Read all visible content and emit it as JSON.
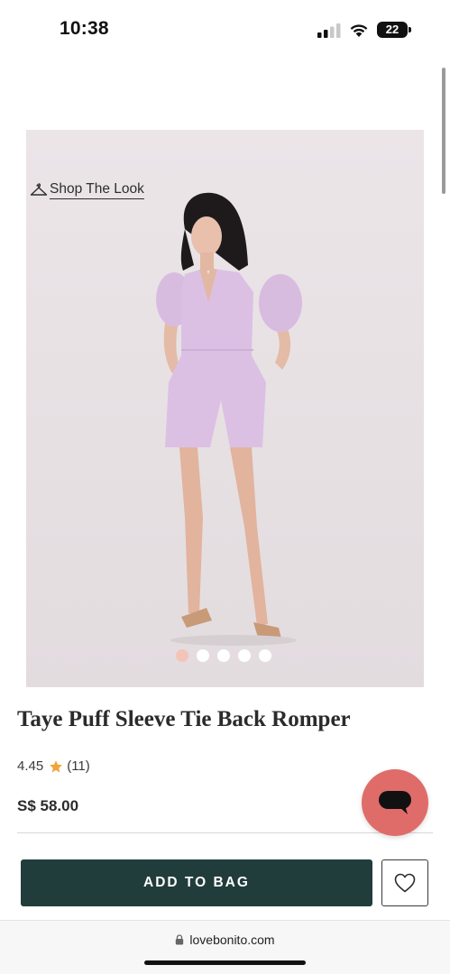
{
  "status_bar": {
    "time": "10:38",
    "battery": "22",
    "icons": [
      "cellular-signal-icon",
      "wifi-icon",
      "battery-icon"
    ]
  },
  "product": {
    "shop_the_look": "Shop The Look",
    "image_alt_icon": "hanger-icon",
    "carousel": {
      "total": 5,
      "active_index": 0
    },
    "title": "Taye Puff Sleeve Tie Back Romper",
    "rating": "4.45",
    "review_count": "(11)",
    "price": "S$ 58.00"
  },
  "actions": {
    "add_to_bag": "ADD TO BAG",
    "wishlist_icon": "heart-icon",
    "chat_icon": "chat-bubble-icon"
  },
  "browser": {
    "url": "lovebonito.com"
  },
  "colors": {
    "accent_dark_green": "#213d3b",
    "chat_button": "#e06c6a",
    "star": "#f0a53a",
    "active_dot": "#f3c4b8",
    "image_background": "#e9e3e6",
    "romper": "#dcc0e4"
  }
}
